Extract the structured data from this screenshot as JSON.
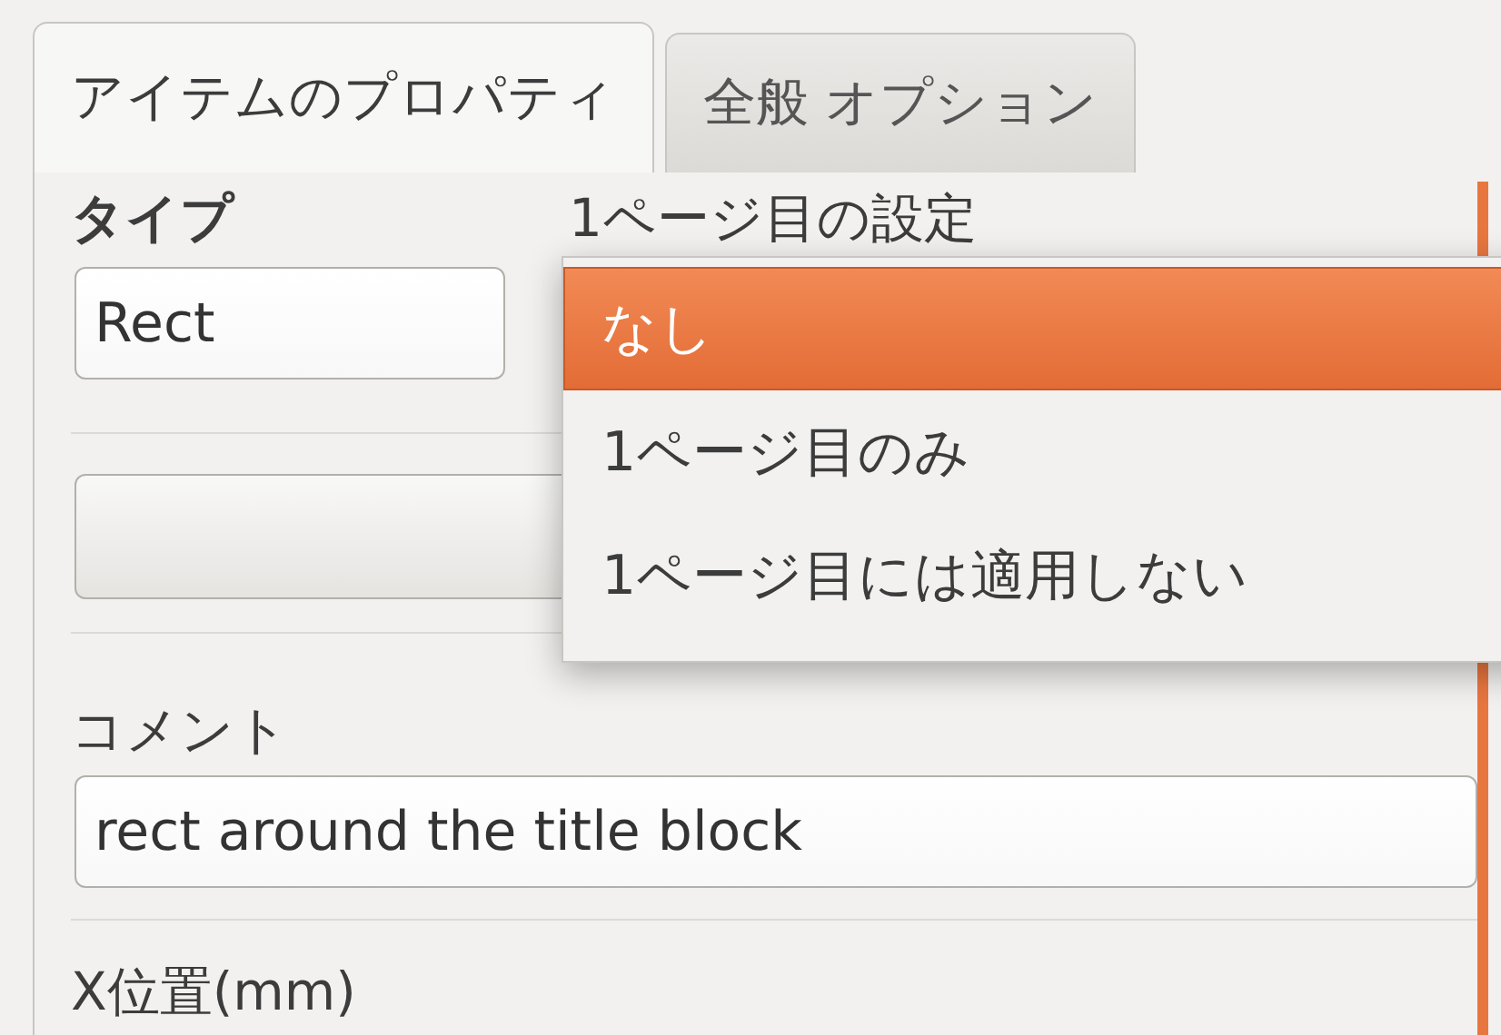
{
  "tabs": [
    {
      "label": "アイテムのプロパティ",
      "selected": true
    },
    {
      "label": "全般 オプション",
      "selected": false
    }
  ],
  "type_label": "タイプ",
  "type_value": "Rect",
  "first_page_label": "1ページ目の設定",
  "first_page_menu": [
    {
      "label": "なし",
      "selected": true
    },
    {
      "label": "1ページ目のみ",
      "selected": false
    },
    {
      "label": "1ページ目には適用しない",
      "selected": false
    }
  ],
  "comment_label": "コメント",
  "comment_value": "rect around the title block",
  "x_position_label": "X位置(mm)"
}
